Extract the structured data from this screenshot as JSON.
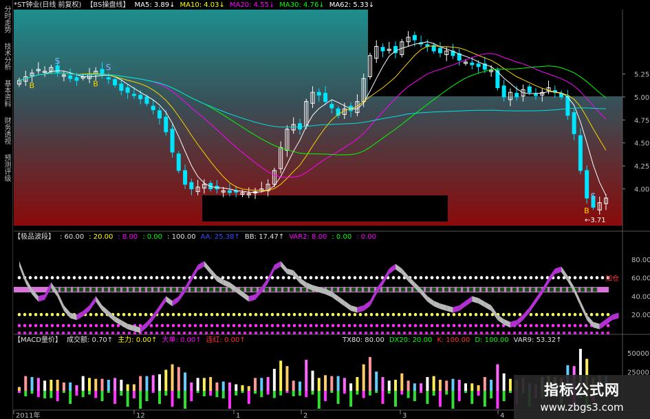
{
  "sidebar": {
    "tabs": [
      "分时走势",
      "技术分析",
      "基本资料",
      "财务透视",
      "预测评级"
    ]
  },
  "panel_main": {
    "header": [
      {
        "text": "*ST钟业(日线 前复权)",
        "color": "#e0e0e0"
      },
      {
        "text": "【BS操盘线】",
        "color": "#e0e0e0"
      },
      {
        "text": "MA5: 3.89↓",
        "color": "#ffffff"
      },
      {
        "text": "MA10: 4.03↓",
        "color": "#ffff00"
      },
      {
        "text": "MA20: 4.55↓",
        "color": "#ff00ff"
      },
      {
        "text": "MA30: 4.76↓",
        "color": "#00ff00"
      },
      {
        "text": "MA62: 5.33↓",
        "color": "#ffffff"
      }
    ],
    "y_ticks": [
      "5.25",
      "5.00",
      "4.75",
      "4.50",
      "4.25",
      "4.00"
    ],
    "low_label": "3.71",
    "signal_s": "S",
    "signal_b": "B"
  },
  "panel_osc": {
    "header": [
      {
        "text": "【极品波段】",
        "color": "#e0e0e0"
      },
      {
        "text": ": 60.00",
        "color": "#e0e0e0"
      },
      {
        "text": ": 20.00",
        "color": "#ffff00"
      },
      {
        "text": ": 8.00",
        "color": "#ff00ff"
      },
      {
        "text": ": 0.00",
        "color": "#00ff00"
      },
      {
        "text": ": 100.00",
        "color": "#e0e0e0"
      },
      {
        "text": "AA: 25.38↑",
        "color": "#3050ff"
      },
      {
        "text": "BB: 17.47↑",
        "color": "#e0e0e0"
      },
      {
        "text": "VAR2: 8.00",
        "color": "#ff00ff"
      },
      {
        "text": ": 0.00",
        "color": "#00ff00"
      },
      {
        "text": ": 0.00",
        "color": "#ff00ff"
      }
    ],
    "y_ticks": [
      "80.00",
      "60.00",
      "40.00",
      "20.00"
    ],
    "tag_text": "加仓"
  },
  "panel_vol": {
    "header": [
      {
        "text": "【MACD量价】",
        "color": "#e0e0e0"
      },
      {
        "text": "成交额: 0.70↑",
        "color": "#e0e0e0"
      },
      {
        "text": "主力: 0.00↑",
        "color": "#ffff00"
      },
      {
        "text": "大单: 0.00↑",
        "color": "#ff00ff"
      },
      {
        "text": "连红: 0.00↑",
        "color": "#ff3030"
      }
    ],
    "header_right": [
      {
        "text": "TX80: 80.00",
        "color": "#e0e0e0"
      },
      {
        "text": "DX20: 20.00",
        "color": "#00ff00"
      },
      {
        "text": "K: 100.00",
        "color": "#ff3030"
      },
      {
        "text": "D: 100.00",
        "color": "#00ff00"
      },
      {
        "text": "VAR9: 53.32↑",
        "color": "#e0e0e0"
      }
    ],
    "y_ticks": [
      "50000",
      "25000"
    ]
  },
  "x_axis": {
    "labels": [
      "2011年",
      "12",
      "1",
      "2",
      "3",
      "4"
    ]
  },
  "watermark": {
    "title": "指标公式网",
    "url": "www.zbgs3.com"
  },
  "chart_data": {
    "type": "candlestick",
    "price_close": [
      5.18,
      5.22,
      5.26,
      5.3,
      5.28,
      5.32,
      5.27,
      5.24,
      5.2,
      5.18,
      5.22,
      5.25,
      5.28,
      5.24,
      5.2,
      5.13,
      5.07,
      5.05,
      5.02,
      4.98,
      4.93,
      4.86,
      4.77,
      4.62,
      4.4,
      4.2,
      4.05,
      4.0,
      4.02,
      4.05,
      4.0,
      4.0,
      3.98,
      3.96,
      3.97,
      3.96,
      3.95,
      3.97,
      4.0,
      4.05,
      4.2,
      4.45,
      4.65,
      4.7,
      4.65,
      4.95,
      5.05,
      5.02,
      4.95,
      4.88,
      4.8,
      4.87,
      4.85,
      4.95,
      5.2,
      5.45,
      5.55,
      5.5,
      5.52,
      5.48,
      5.6,
      5.65,
      5.62,
      5.58,
      5.55,
      5.5,
      5.48,
      5.5,
      5.45,
      5.4,
      5.38,
      5.35,
      5.33,
      5.3,
      5.29,
      5.1,
      5.0,
      5.05,
      5.0,
      5.08,
      5.05,
      5.02,
      5.05,
      5.1,
      5.05,
      5.0,
      4.8,
      4.6,
      4.2,
      3.9,
      3.8,
      3.85,
      3.9
    ],
    "ma_series": [
      {
        "name": "MA5",
        "last": 3.89
      },
      {
        "name": "MA10",
        "last": 4.03
      },
      {
        "name": "MA20",
        "last": 4.55
      },
      {
        "name": "MA30",
        "last": 4.76
      },
      {
        "name": "MA62",
        "last": 5.33
      }
    ],
    "price_ylim": [
      3.6,
      5.8
    ],
    "osc_ylim": [
      0,
      100
    ],
    "osc_levels": [
      60,
      20,
      8,
      0
    ],
    "oscillator": [
      78,
      60,
      48,
      40,
      42,
      55,
      45,
      30,
      22,
      20,
      24,
      30,
      40,
      30,
      24,
      18,
      14,
      10,
      8,
      6,
      12,
      20,
      30,
      40,
      35,
      40,
      50,
      62,
      74,
      78,
      70,
      62,
      58,
      55,
      50,
      45,
      40,
      42,
      50,
      60,
      74,
      78,
      70,
      68,
      60,
      55,
      52,
      50,
      48,
      45,
      40,
      35,
      30,
      28,
      30,
      35,
      48,
      58,
      70,
      75,
      70,
      62,
      55,
      48,
      40,
      35,
      32,
      30,
      28,
      30,
      35,
      40,
      38,
      34,
      30,
      20,
      15,
      12,
      14,
      20,
      28,
      38,
      48,
      60,
      70,
      72,
      62,
      50,
      35,
      20,
      12,
      10,
      15,
      20,
      22
    ],
    "volume_ylim": [
      0,
      60000
    ]
  }
}
